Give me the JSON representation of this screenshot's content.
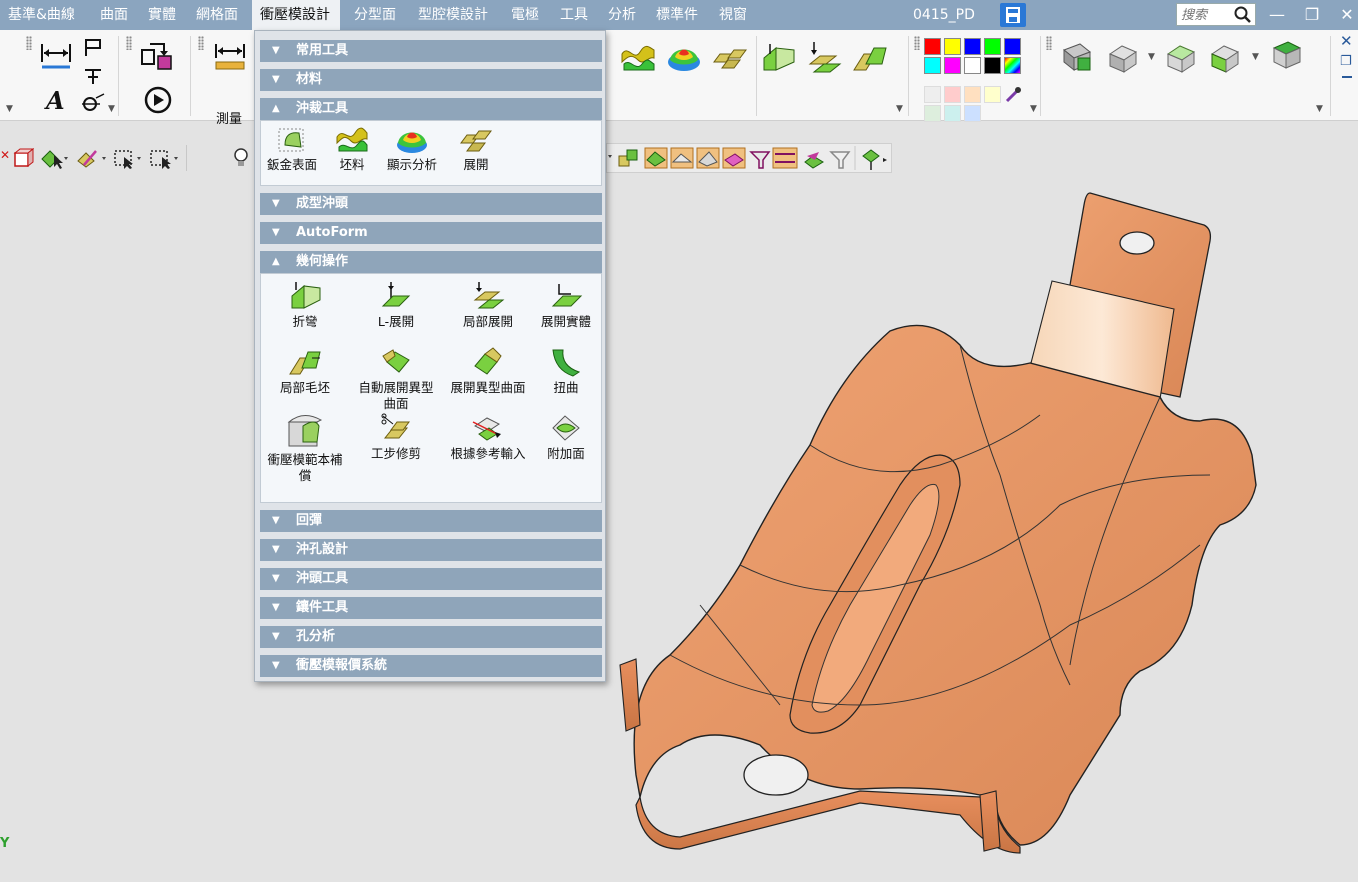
{
  "menubar": {
    "items": [
      "基準&曲線",
      "曲面",
      "實體",
      "網格面",
      "衝壓模設計",
      "分型面",
      "型腔模設計",
      "電極",
      "工具",
      "分析",
      "標準件",
      "視窗"
    ],
    "active_index": 4,
    "document_title": "0415_PD",
    "search_placeholder": "搜索",
    "window_controls": {
      "minimize": "—",
      "restore": "❐",
      "close": "✕"
    }
  },
  "ribbon": {
    "measure_label": "測量",
    "palette_colors": [
      "#ff0000",
      "#ffff00",
      "#0000ff",
      "#00ff00",
      "#0000ff",
      "#00ffff",
      "#ff00ff",
      "#ffffff",
      "#000000"
    ],
    "light_palette_colors": [
      "#eeeeee",
      "#ffcccc",
      "#ffe0c0",
      "#ffffcc",
      "#ddeedd",
      "#ccf0ee",
      "#cce0ff"
    ]
  },
  "panel": {
    "sections": [
      {
        "label": "常用工具",
        "expanded": false
      },
      {
        "label": "材料",
        "expanded": false
      },
      {
        "label": "沖裁工具",
        "expanded": true,
        "tools": [
          "鈑金表面",
          "坯料",
          "顯示分析",
          "展開"
        ]
      },
      {
        "label": "成型沖頭",
        "expanded": false
      },
      {
        "label": "AutoForm",
        "expanded": false
      },
      {
        "label": "幾何操作",
        "expanded": true,
        "tools": [
          "折彎",
          "L-展開",
          "局部展開",
          "展開實體",
          "局部毛坯",
          "自動展開異型曲面",
          "展開異型曲面",
          "扭曲",
          "衝壓模範本補償",
          "工步修剪",
          "根據參考輸入",
          "附加面"
        ]
      },
      {
        "label": "回彈",
        "expanded": false
      },
      {
        "label": "沖孔設計",
        "expanded": false
      },
      {
        "label": "沖頭工具",
        "expanded": false
      },
      {
        "label": "鑲件工具",
        "expanded": false
      },
      {
        "label": "孔分析",
        "expanded": false
      },
      {
        "label": "衝壓模報價系統",
        "expanded": false
      }
    ]
  },
  "viewport": {
    "axis_label": "Y",
    "part_color": "#e8996a"
  }
}
